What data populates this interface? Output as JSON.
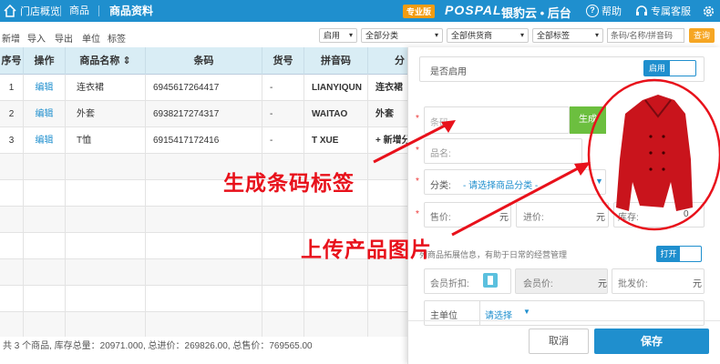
{
  "topbar": {
    "home": "门店概览",
    "crumb1": "商品",
    "crumb2": "商品资料",
    "edition": "专业版",
    "brand": "POSPAL",
    "brand_cn": "银豹云 • 后台",
    "help": "帮助",
    "service": "专属客服"
  },
  "toolbar": {
    "links": [
      "新增",
      "导入",
      "导出",
      "单位",
      "标签"
    ],
    "filters": [
      "启用",
      "全部分类",
      "全部供货商",
      "全部标签"
    ],
    "search_placeholder": "条码/名称/拼音码",
    "query": "查询"
  },
  "table": {
    "headers": [
      "序号",
      "操作",
      "商品名称 ⇕",
      "条码",
      "货号",
      "拼音码",
      "分"
    ],
    "rows": [
      [
        "1",
        "编辑",
        "连衣裙",
        "6945617264417",
        "-",
        "LIANYIQUN",
        "连衣裙"
      ],
      [
        "2",
        "编辑",
        "外套",
        "6938217274317",
        "-",
        "WAITAO",
        "外套"
      ],
      [
        "3",
        "编辑",
        "T恤",
        "6915417172416",
        "-",
        "T XUE",
        "+ 新增分..."
      ]
    ]
  },
  "footer": "共 3 个商品, 库存总量：20971.000, 总进价：269826.00, 总售价：769565.00",
  "panel": {
    "enable_label": "是否启用",
    "enable_value": "启用",
    "barcode_placeholder": "条码",
    "generate": "生成",
    "name_placeholder": "品名:",
    "category_label": "分类:",
    "category_value": "- 请选择商品分类 -",
    "price_label": "售价:",
    "price_unit": "元",
    "cost_label": "进价:",
    "cost_unit": "元",
    "stock_label": "库存:",
    "stock_value": "0",
    "ext_text": "列商品拓展信息，有助于日常的经营管理",
    "ext_toggle": "打开",
    "member_discount": "会员折扣:",
    "member_price": "会员价:",
    "member_unit": "元",
    "wholesale": "批发价:",
    "wholesale_unit": "元",
    "main_unit": "主单位",
    "choose": "请选择",
    "cancel": "取消",
    "save": "保存"
  },
  "annotations": {
    "barcode": "生成条码标签",
    "image": "上传产品图片"
  }
}
